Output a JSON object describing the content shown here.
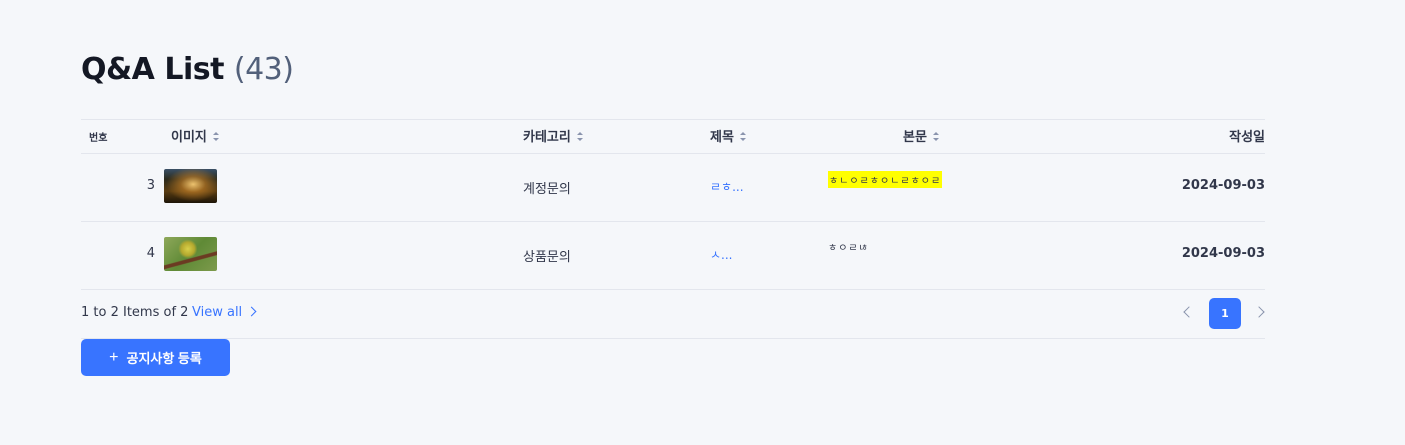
{
  "page": {
    "title": "Q&A List",
    "count": "(43)"
  },
  "table": {
    "headers": {
      "no": "번호",
      "image": "이미지",
      "category": "카테고리",
      "subject": "제목",
      "body": "본문",
      "date": "작성일"
    },
    "rows": [
      {
        "no": "3",
        "image": "forest-thumbnail",
        "category": "계정문의",
        "subject": "ㄹㅎ...",
        "body": "ㅎㄴㅇㄹㅎㅇㄴㄹㅎㅇㄹ",
        "body_highlight": "#ffff00",
        "date": "2024-09-03"
      },
      {
        "no": "4",
        "image": "bird-thumbnail",
        "category": "상품문의",
        "subject": "ㅅ...",
        "body": "ㅎㅇㄹㄶ",
        "date": "2024-09-03"
      }
    ]
  },
  "footer": {
    "summary": "1 to 2 Items of 2",
    "view_all": "View all",
    "current_page": "1"
  },
  "actions": {
    "add_label": "공지사항 등록",
    "add_icon": "plus-icon"
  },
  "colors": {
    "accent": "#3874ff",
    "background": "#f5f7fa",
    "highlight": "#ffff00"
  }
}
